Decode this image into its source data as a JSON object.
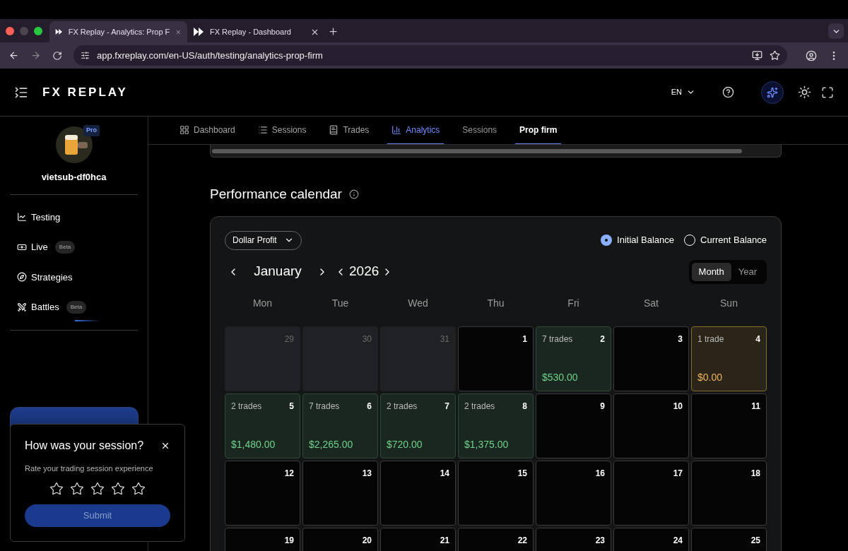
{
  "browser": {
    "tabs": [
      {
        "title": "FX Replay - Analytics: Prop F",
        "selected": true
      },
      {
        "title": "FX Replay - Dashboard",
        "selected": false
      }
    ],
    "url": "app.fxreplay.com/en-US/auth/testing/analytics-prop-firm"
  },
  "header": {
    "logo": "FX REPLAY",
    "language": "EN"
  },
  "sidebar": {
    "badge": "Pro",
    "username": "vietsub-df0hca",
    "items": [
      {
        "label": "Testing"
      },
      {
        "label": "Live",
        "badge": "Beta"
      },
      {
        "label": "Strategies"
      },
      {
        "label": "Battles",
        "badge": "Beta"
      }
    ]
  },
  "nav_tabs": [
    {
      "label": "Dashboard",
      "kind": "main",
      "selected": false
    },
    {
      "label": "Sessions",
      "kind": "main",
      "selected": false
    },
    {
      "label": "Trades",
      "kind": "main",
      "selected": false
    },
    {
      "label": "Analytics",
      "kind": "main",
      "selected": true
    },
    {
      "label": "Sessions",
      "kind": "sub",
      "selected": false
    },
    {
      "label": "Prop firm",
      "kind": "sub",
      "selected": true
    }
  ],
  "calendar": {
    "title": "Performance calendar",
    "metric": "Dollar Profit",
    "balance_options": [
      {
        "label": "Initial Balance",
        "selected": true
      },
      {
        "label": "Current Balance",
        "selected": false
      }
    ],
    "month": "January",
    "year": "2026",
    "views": [
      {
        "label": "Month",
        "selected": true
      },
      {
        "label": "Year",
        "selected": false
      }
    ],
    "weekdays": [
      "Mon",
      "Tue",
      "Wed",
      "Thu",
      "Fri",
      "Sat",
      "Sun"
    ],
    "days": [
      {
        "day": "29",
        "kind": "outside"
      },
      {
        "day": "30",
        "kind": "outside"
      },
      {
        "day": "31",
        "kind": "outside"
      },
      {
        "day": "1",
        "kind": "empty"
      },
      {
        "day": "2",
        "kind": "profit",
        "trades": "7 trades",
        "amount": "$530.00"
      },
      {
        "day": "3",
        "kind": "empty"
      },
      {
        "day": "4",
        "kind": "breakeven",
        "trades": "1 trade",
        "amount": "$0.00"
      },
      {
        "day": "5",
        "kind": "profit",
        "trades": "2 trades",
        "amount": "$1,480.00"
      },
      {
        "day": "6",
        "kind": "profit",
        "trades": "7 trades",
        "amount": "$2,265.00"
      },
      {
        "day": "7",
        "kind": "profit",
        "trades": "2 trades",
        "amount": "$720.00"
      },
      {
        "day": "8",
        "kind": "profit",
        "trades": "2 trades",
        "amount": "$1,375.00"
      },
      {
        "day": "9",
        "kind": "empty"
      },
      {
        "day": "10",
        "kind": "empty"
      },
      {
        "day": "11",
        "kind": "empty"
      },
      {
        "day": "12",
        "kind": "empty"
      },
      {
        "day": "13",
        "kind": "empty"
      },
      {
        "day": "14",
        "kind": "empty"
      },
      {
        "day": "15",
        "kind": "empty"
      },
      {
        "day": "16",
        "kind": "empty"
      },
      {
        "day": "17",
        "kind": "empty"
      },
      {
        "day": "18",
        "kind": "empty"
      },
      {
        "day": "19",
        "kind": "empty"
      },
      {
        "day": "20",
        "kind": "empty"
      },
      {
        "day": "21",
        "kind": "empty"
      },
      {
        "day": "22",
        "kind": "empty"
      },
      {
        "day": "23",
        "kind": "empty"
      },
      {
        "day": "24",
        "kind": "empty"
      },
      {
        "day": "25",
        "kind": "empty"
      }
    ]
  },
  "feedback": {
    "title": "How was your session?",
    "subtitle": "Rate your trading session experience",
    "stars": 0,
    "submit": "Submit",
    "submit_disabled": true
  }
}
